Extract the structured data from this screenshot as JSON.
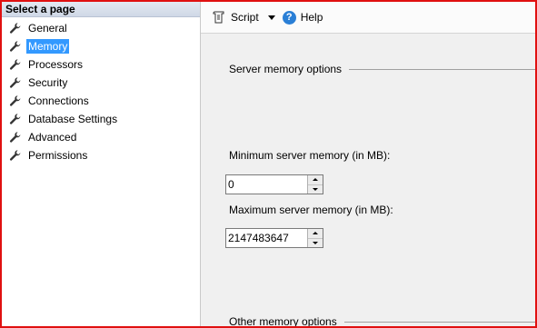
{
  "sidebar": {
    "header": "Select a page",
    "items": [
      {
        "label": "General"
      },
      {
        "label": "Memory"
      },
      {
        "label": "Processors"
      },
      {
        "label": "Security"
      },
      {
        "label": "Connections"
      },
      {
        "label": "Database Settings"
      },
      {
        "label": "Advanced"
      },
      {
        "label": "Permissions"
      }
    ],
    "selected": "Memory"
  },
  "toolbar": {
    "script_label": "Script",
    "help_label": "Help"
  },
  "memory": {
    "section_title": "Server memory options",
    "min_label": "Minimum server memory (in MB):",
    "min_value": "0",
    "max_label": "Maximum server memory (in MB):",
    "max_value": "2147483647",
    "other_section_title": "Other memory options"
  },
  "colors": {
    "selection": "#3399ff",
    "frame_border": "#e01010"
  }
}
